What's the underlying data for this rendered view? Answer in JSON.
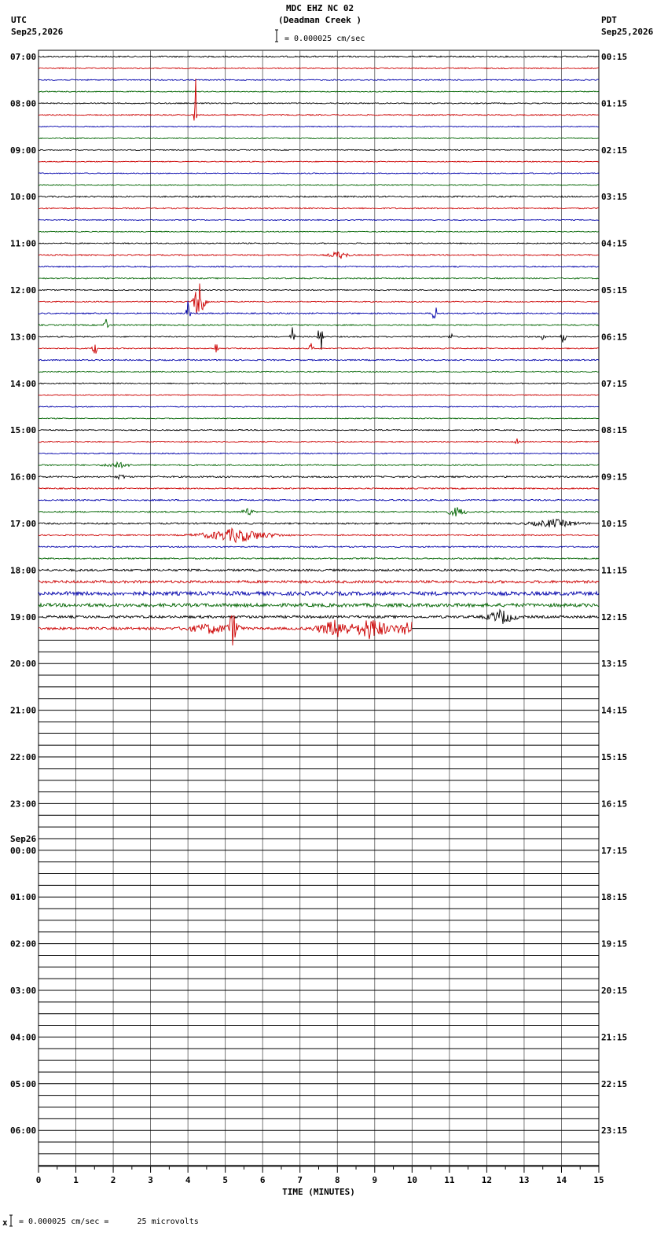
{
  "header": {
    "station": "MDC EHZ NC 02",
    "location": "(Deadman Creek )",
    "scale": "= 0.000025 cm/sec",
    "left_tz": "UTC",
    "left_date": "Sep25,2026",
    "right_tz": "PDT",
    "right_date": "Sep25,2026"
  },
  "footer": {
    "scale_note": "= 0.000025 cm/sec =      25 microvolts"
  },
  "chart_data": {
    "type": "line",
    "title": "MDC EHZ NC 02 (Deadman Creek )",
    "xlabel": "TIME (MINUTES)",
    "xlim": [
      0,
      15
    ],
    "x_ticks": [
      "0",
      "1",
      "2",
      "3",
      "4",
      "5",
      "6",
      "7",
      "8",
      "9",
      "10",
      "11",
      "12",
      "13",
      "14",
      "15"
    ],
    "rows": 96,
    "rows_per_hour": 4,
    "row_minutes": 15,
    "trace_colors": [
      "#000000",
      "#cc0000",
      "#0000aa",
      "#006400"
    ],
    "left_hour_labels": [
      "07:00",
      "08:00",
      "09:00",
      "10:00",
      "11:00",
      "12:00",
      "13:00",
      "14:00",
      "15:00",
      "16:00",
      "17:00",
      "18:00",
      "19:00",
      "20:00",
      "21:00",
      "22:00",
      "23:00",
      "00:00",
      "01:00",
      "02:00",
      "03:00",
      "04:00",
      "05:00",
      "06:00"
    ],
    "next_day_label": "Sep26",
    "next_day_at_hour_index": 17,
    "right_hour_labels": [
      "00:15",
      "01:15",
      "02:15",
      "03:15",
      "04:15",
      "05:15",
      "06:15",
      "07:15",
      "08:15",
      "09:15",
      "10:15",
      "11:15",
      "12:15",
      "13:15",
      "14:15",
      "15:15",
      "16:15",
      "17:15",
      "18:15",
      "19:15",
      "20:15",
      "21:15",
      "22:15",
      "23:15"
    ],
    "recorded_rows": 49,
    "last_row_end_minute": 10,
    "noise_levels": [
      0.9,
      0.7,
      0.7,
      0.6,
      0.7,
      0.7,
      0.6,
      0.6,
      0.6,
      0.6,
      0.6,
      0.6,
      0.9,
      0.8,
      0.6,
      0.6,
      0.7,
      0.8,
      0.7,
      0.8,
      0.7,
      0.7,
      0.8,
      0.8,
      0.7,
      0.7,
      0.8,
      0.7,
      0.7,
      0.6,
      0.6,
      0.6,
      0.7,
      0.7,
      0.7,
      0.8,
      1.0,
      0.8,
      0.9,
      0.9,
      1.0,
      0.8,
      0.8,
      0.9,
      1.3,
      1.6,
      2.4,
      2.2,
      1.6,
      1.6
    ],
    "events": [
      {
        "row": 5,
        "minute": 4.2,
        "amplitude": 75,
        "duration": 0.05
      },
      {
        "row": 17,
        "minute": 8.05,
        "amplitude": 5,
        "duration": 0.5
      },
      {
        "row": 21,
        "minute": 4.3,
        "amplitude": 30,
        "duration": 0.3
      },
      {
        "row": 22,
        "minute": 4.0,
        "amplitude": 18,
        "duration": 0.1
      },
      {
        "row": 22,
        "minute": 10.6,
        "amplitude": 28,
        "duration": 0.1
      },
      {
        "row": 23,
        "minute": 1.8,
        "amplitude": 14,
        "duration": 0.1
      },
      {
        "row": 24,
        "minute": 6.8,
        "amplitude": 14,
        "duration": 0.1
      },
      {
        "row": 24,
        "minute": 7.55,
        "amplitude": 48,
        "duration": 0.1
      },
      {
        "row": 24,
        "minute": 11.05,
        "amplitude": 8,
        "duration": 0.1
      },
      {
        "row": 24,
        "minute": 13.5,
        "amplitude": 8,
        "duration": 0.1
      },
      {
        "row": 24,
        "minute": 14.05,
        "amplitude": 14,
        "duration": 0.1
      },
      {
        "row": 25,
        "minute": 1.5,
        "amplitude": 16,
        "duration": 0.1
      },
      {
        "row": 25,
        "minute": 4.75,
        "amplitude": 10,
        "duration": 0.1
      },
      {
        "row": 25,
        "minute": 7.3,
        "amplitude": 10,
        "duration": 0.1
      },
      {
        "row": 33,
        "minute": 12.8,
        "amplitude": 5,
        "duration": 0.1
      },
      {
        "row": 35,
        "minute": 2.1,
        "amplitude": 4,
        "duration": 0.6
      },
      {
        "row": 36,
        "minute": 2.2,
        "amplitude": 4,
        "duration": 0.2
      },
      {
        "row": 39,
        "minute": 5.6,
        "amplitude": 5,
        "duration": 0.3
      },
      {
        "row": 39,
        "minute": 11.2,
        "amplitude": 6,
        "duration": 0.5
      },
      {
        "row": 40,
        "minute": 13.8,
        "amplitude": 5,
        "duration": 1.2
      },
      {
        "row": 41,
        "minute": 5.3,
        "amplitude": 9,
        "duration": 1.8
      },
      {
        "row": 48,
        "minute": 12.4,
        "amplitude": 9,
        "duration": 0.7
      },
      {
        "row": 49,
        "minute": 4.6,
        "amplitude": 6,
        "duration": 1.2
      },
      {
        "row": 49,
        "minute": 5.2,
        "amplitude": 22,
        "duration": 0.3
      },
      {
        "row": 49,
        "minute": 8.0,
        "amplitude": 12,
        "duration": 1.0
      },
      {
        "row": 49,
        "minute": 8.9,
        "amplitude": 14,
        "duration": 1.0
      },
      {
        "row": 49,
        "minute": 9.9,
        "amplitude": 10,
        "duration": 0.8
      },
      {
        "row": 50,
        "minute": 3.2,
        "amplitude": 6,
        "duration": 0.4
      },
      {
        "row": 50,
        "minute": 5.2,
        "amplitude": 12,
        "duration": 0.4
      },
      {
        "row": 50,
        "minute": 8.7,
        "amplitude": 10,
        "duration": 0.8
      },
      {
        "row": 50,
        "minute": 12.4,
        "amplitude": 6,
        "duration": 0.4
      },
      {
        "row": 51,
        "minute": 0.3,
        "amplitude": 5,
        "duration": 0.4
      },
      {
        "row": 51,
        "minute": 5.9,
        "amplitude": 6,
        "duration": 0.3
      },
      {
        "row": 51,
        "minute": 8.7,
        "amplitude": 6,
        "duration": 0.5
      },
      {
        "row": 51,
        "minute": 9.5,
        "amplitude": 10,
        "duration": 0.8
      },
      {
        "row": 52,
        "minute": 5.2,
        "amplitude": 5,
        "duration": 0.4
      },
      {
        "row": 52,
        "minute": 9.4,
        "amplitude": 8,
        "duration": 0.5
      },
      {
        "row": 53,
        "minute": 0.05,
        "amplitude": 10,
        "duration": 0.15
      },
      {
        "row": 53,
        "minute": 7.4,
        "amplitude": 4,
        "duration": 0.2
      }
    ]
  }
}
